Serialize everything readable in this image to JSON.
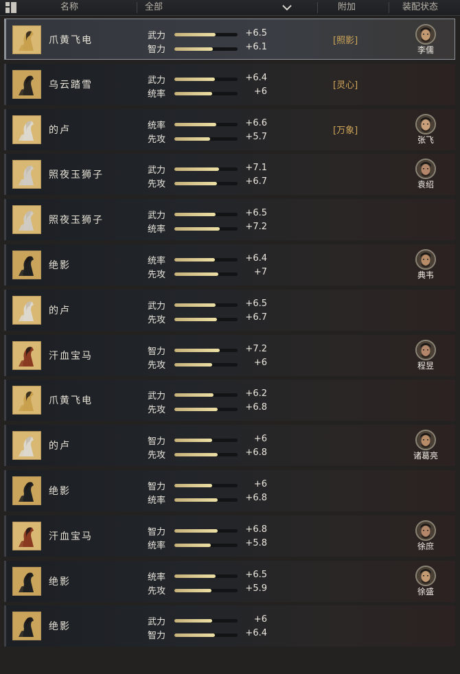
{
  "header": {
    "name_label": "名称",
    "filter_label": "全部",
    "bonus_label": "附加",
    "equip_label": "装配状态"
  },
  "horses": [
    {
      "name": "爪黄飞电",
      "coat": "gold",
      "attr1": "武力",
      "val1": "+6.5",
      "pct1": 0.65,
      "attr2": "智力",
      "val2": "+6.1",
      "pct2": 0.61,
      "bonus": "[照影]",
      "general": "李儒",
      "selected": true
    },
    {
      "name": "乌云踏雪",
      "coat": "black",
      "attr1": "武力",
      "val1": "+6.4",
      "pct1": 0.64,
      "attr2": "统率",
      "val2": "+6",
      "pct2": 0.6,
      "bonus": "[灵心]",
      "general": ""
    },
    {
      "name": "的卢",
      "coat": "white",
      "attr1": "统率",
      "val1": "+6.6",
      "pct1": 0.66,
      "attr2": "先攻",
      "val2": "+5.7",
      "pct2": 0.57,
      "bonus": "[万象]",
      "general": "张飞"
    },
    {
      "name": "照夜玉狮子",
      "coat": "silver",
      "attr1": "武力",
      "val1": "+7.1",
      "pct1": 0.71,
      "attr2": "先攻",
      "val2": "+6.7",
      "pct2": 0.67,
      "bonus": "",
      "general": "袁绍"
    },
    {
      "name": "照夜玉狮子",
      "coat": "silver",
      "attr1": "武力",
      "val1": "+6.5",
      "pct1": 0.65,
      "attr2": "统率",
      "val2": "+7.2",
      "pct2": 0.72,
      "bonus": "",
      "general": ""
    },
    {
      "name": "绝影",
      "coat": "dark",
      "attr1": "统率",
      "val1": "+6.4",
      "pct1": 0.64,
      "attr2": "先攻",
      "val2": "+7",
      "pct2": 0.7,
      "bonus": "",
      "general": "典韦"
    },
    {
      "name": "的卢",
      "coat": "white",
      "attr1": "武力",
      "val1": "+6.5",
      "pct1": 0.65,
      "attr2": "先攻",
      "val2": "+6.7",
      "pct2": 0.67,
      "bonus": "",
      "general": ""
    },
    {
      "name": "汗血宝马",
      "coat": "red",
      "attr1": "智力",
      "val1": "+7.2",
      "pct1": 0.72,
      "attr2": "先攻",
      "val2": "+6",
      "pct2": 0.6,
      "bonus": "",
      "general": "程昱"
    },
    {
      "name": "爪黄飞电",
      "coat": "gold",
      "attr1": "武力",
      "val1": "+6.2",
      "pct1": 0.62,
      "attr2": "先攻",
      "val2": "+6.8",
      "pct2": 0.68,
      "bonus": "",
      "general": ""
    },
    {
      "name": "的卢",
      "coat": "white",
      "attr1": "智力",
      "val1": "+6",
      "pct1": 0.6,
      "attr2": "先攻",
      "val2": "+6.8",
      "pct2": 0.68,
      "bonus": "",
      "general": "诸葛亮"
    },
    {
      "name": "绝影",
      "coat": "dark",
      "attr1": "智力",
      "val1": "+6",
      "pct1": 0.6,
      "attr2": "统率",
      "val2": "+6.8",
      "pct2": 0.68,
      "bonus": "",
      "general": ""
    },
    {
      "name": "汗血宝马",
      "coat": "red",
      "attr1": "智力",
      "val1": "+6.8",
      "pct1": 0.68,
      "attr2": "统率",
      "val2": "+5.8",
      "pct2": 0.58,
      "bonus": "",
      "general": "徐庶"
    },
    {
      "name": "绝影",
      "coat": "dark",
      "attr1": "统率",
      "val1": "+6.5",
      "pct1": 0.65,
      "attr2": "先攻",
      "val2": "+5.9",
      "pct2": 0.59,
      "bonus": "",
      "general": "徐盛"
    },
    {
      "name": "绝影",
      "coat": "dark",
      "attr1": "武力",
      "val1": "+6",
      "pct1": 0.6,
      "attr2": "智力",
      "val2": "+6.4",
      "pct2": 0.64,
      "bonus": "",
      "general": ""
    }
  ],
  "colors": {
    "gold": "#c9a14e",
    "black": "#2a2622",
    "white": "#ddd8cd",
    "silver": "#cfcbc3",
    "dark": "#1e2022",
    "red": "#8a3a20"
  }
}
